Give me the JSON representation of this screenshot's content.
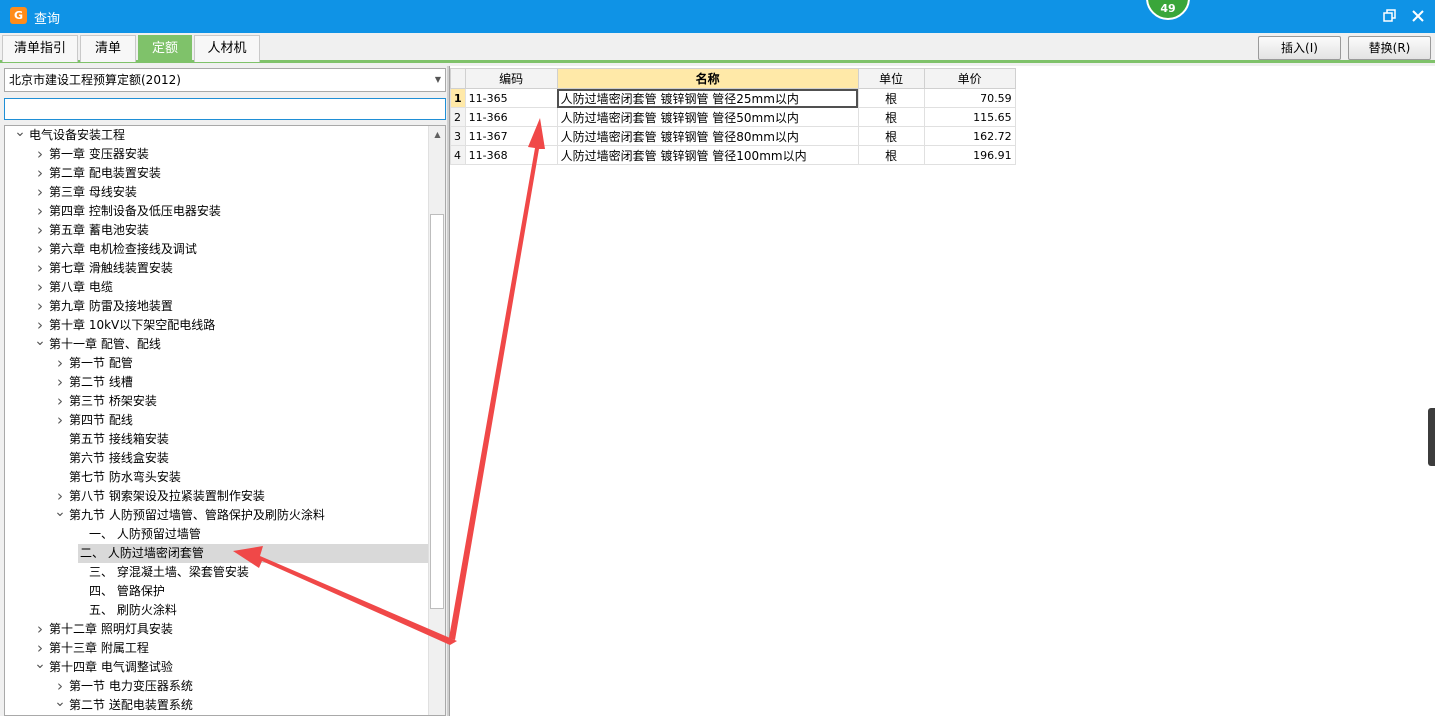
{
  "window": {
    "title": "查询",
    "badge": "49"
  },
  "tabs": [
    {
      "label": "清单指引",
      "active": false
    },
    {
      "label": "清单",
      "active": false
    },
    {
      "label": "定额",
      "active": true
    },
    {
      "label": "人材机",
      "active": false
    }
  ],
  "actions": {
    "insert_label": "插入(I)",
    "replace_label": "替换(R)"
  },
  "library": {
    "selected": "北京市建设工程预算定额(2012)"
  },
  "search": {
    "value": "",
    "placeholder": ""
  },
  "tree": [
    {
      "label": "电气设备安装工程",
      "level": 0,
      "toggle": "expanded"
    },
    {
      "label": "第一章 变压器安装",
      "level": 1,
      "toggle": "collapsed"
    },
    {
      "label": "第二章 配电装置安装",
      "level": 1,
      "toggle": "collapsed"
    },
    {
      "label": "第三章 母线安装",
      "level": 1,
      "toggle": "collapsed"
    },
    {
      "label": "第四章 控制设备及低压电器安装",
      "level": 1,
      "toggle": "collapsed"
    },
    {
      "label": "第五章 蓄电池安装",
      "level": 1,
      "toggle": "collapsed"
    },
    {
      "label": "第六章 电机检查接线及调试",
      "level": 1,
      "toggle": "collapsed"
    },
    {
      "label": "第七章 滑触线装置安装",
      "level": 1,
      "toggle": "collapsed"
    },
    {
      "label": "第八章 电缆",
      "level": 1,
      "toggle": "collapsed"
    },
    {
      "label": "第九章 防雷及接地装置",
      "level": 1,
      "toggle": "collapsed"
    },
    {
      "label": "第十章 10kV以下架空配电线路",
      "level": 1,
      "toggle": "collapsed"
    },
    {
      "label": "第十一章 配管、配线",
      "level": 1,
      "toggle": "expanded"
    },
    {
      "label": "第一节 配管",
      "level": 2,
      "toggle": "collapsed"
    },
    {
      "label": "第二节 线槽",
      "level": 2,
      "toggle": "collapsed"
    },
    {
      "label": "第三节 桥架安装",
      "level": 2,
      "toggle": "collapsed"
    },
    {
      "label": "第四节 配线",
      "level": 2,
      "toggle": "collapsed"
    },
    {
      "label": "第五节 接线箱安装",
      "level": 2,
      "toggle": "none"
    },
    {
      "label": "第六节 接线盒安装",
      "level": 2,
      "toggle": "none"
    },
    {
      "label": "第七节 防水弯头安装",
      "level": 2,
      "toggle": "none"
    },
    {
      "label": "第八节 钢索架设及拉紧装置制作安装",
      "level": 2,
      "toggle": "collapsed"
    },
    {
      "label": "第九节 人防预留过墙管、管路保护及刷防火涂料",
      "level": 2,
      "toggle": "expanded"
    },
    {
      "label": "一、  人防预留过墙管",
      "level": 3,
      "toggle": "none"
    },
    {
      "label": "二、  人防过墙密闭套管",
      "level": 3,
      "toggle": "none",
      "selected": true
    },
    {
      "label": "三、  穿混凝土墙、梁套管安装",
      "level": 3,
      "toggle": "none"
    },
    {
      "label": "四、  管路保护",
      "level": 3,
      "toggle": "none"
    },
    {
      "label": "五、  刷防火涂料",
      "level": 3,
      "toggle": "none"
    },
    {
      "label": "第十二章 照明灯具安装",
      "level": 1,
      "toggle": "collapsed"
    },
    {
      "label": "第十三章 附属工程",
      "level": 1,
      "toggle": "collapsed"
    },
    {
      "label": "第十四章 电气调整试验",
      "level": 1,
      "toggle": "expanded"
    },
    {
      "label": "第一节 电力变压器系统",
      "level": 2,
      "toggle": "collapsed"
    },
    {
      "label": "第二节 送配电装置系统",
      "level": 2,
      "toggle": "expanded"
    }
  ],
  "grid": {
    "columns": [
      "编码",
      "名称",
      "单位",
      "单价"
    ],
    "rows": [
      {
        "num": "1",
        "code": "11-365",
        "name": "人防过墙密闭套管 镀锌钢管 管径25mm以内",
        "unit": "根",
        "price": "70.59"
      },
      {
        "num": "2",
        "code": "11-366",
        "name": "人防过墙密闭套管 镀锌钢管 管径50mm以内",
        "unit": "根",
        "price": "115.65"
      },
      {
        "num": "3",
        "code": "11-367",
        "name": "人防过墙密闭套管 镀锌钢管 管径80mm以内",
        "unit": "根",
        "price": "162.72"
      },
      {
        "num": "4",
        "code": "11-368",
        "name": "人防过墙密闭套管 镀锌钢管 管径100mm以内",
        "unit": "根",
        "price": "196.91"
      }
    ]
  },
  "colors": {
    "titlebar": "#0f93e6",
    "tab_active": "#7fc26a",
    "annotation": "#f04848",
    "name_header": "#ffe9a8"
  }
}
